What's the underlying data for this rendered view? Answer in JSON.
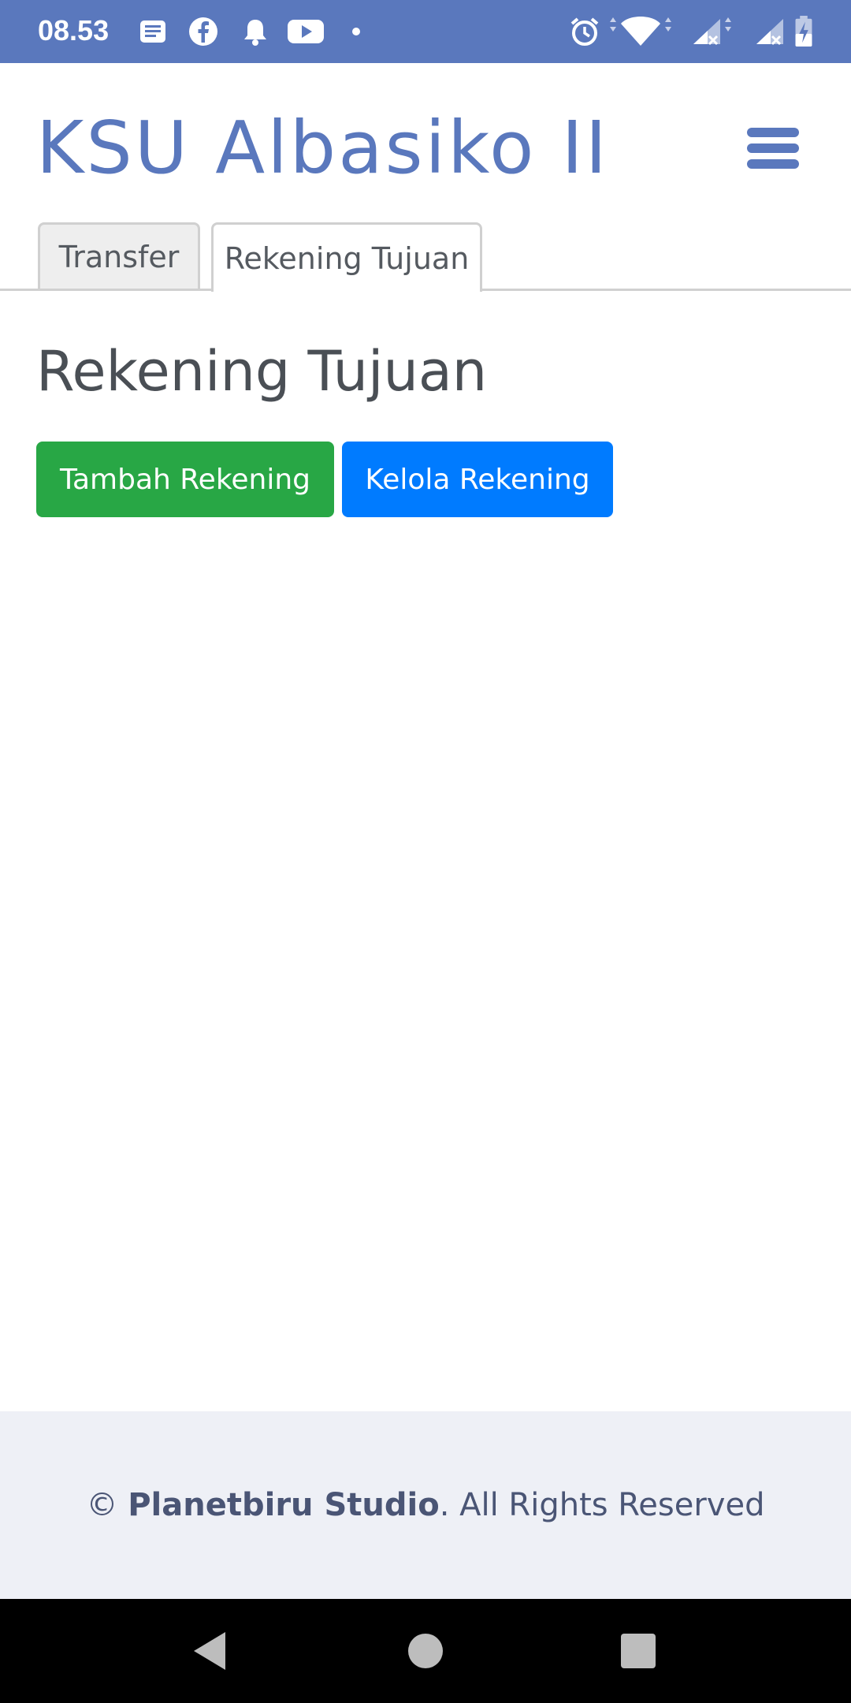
{
  "status_bar": {
    "time": "08.53",
    "icons": [
      "notification-message-icon",
      "facebook-icon",
      "bell-icon",
      "youtube-icon",
      "dot-icon",
      "alarm-icon",
      "wifi-icon",
      "signal-icon",
      "signal-icon",
      "battery-charging-icon"
    ]
  },
  "header": {
    "title": "KSU Albasiko II",
    "menu_icon": "hamburger-menu-icon"
  },
  "tabs": [
    {
      "label": "Transfer",
      "active": false
    },
    {
      "label": "Rekening Tujuan",
      "active": true
    }
  ],
  "main": {
    "heading": "Rekening Tujuan",
    "buttons": {
      "add": "Tambah Rekening",
      "manage": "Kelola Rekening"
    }
  },
  "footer": {
    "copyright_symbol": "©",
    "brand": "Planetbiru Studio",
    "suffix": ". All Rights Reserved"
  },
  "navigation_bar": {
    "back_icon": "back-icon",
    "home_icon": "home-icon",
    "recents_icon": "recents-icon"
  },
  "colors": {
    "status_bar": "#5a78bd",
    "title": "#5a78bd",
    "add_button": "#28a745",
    "manage_button": "#007bff",
    "footer_bg": "#eef0f6"
  }
}
